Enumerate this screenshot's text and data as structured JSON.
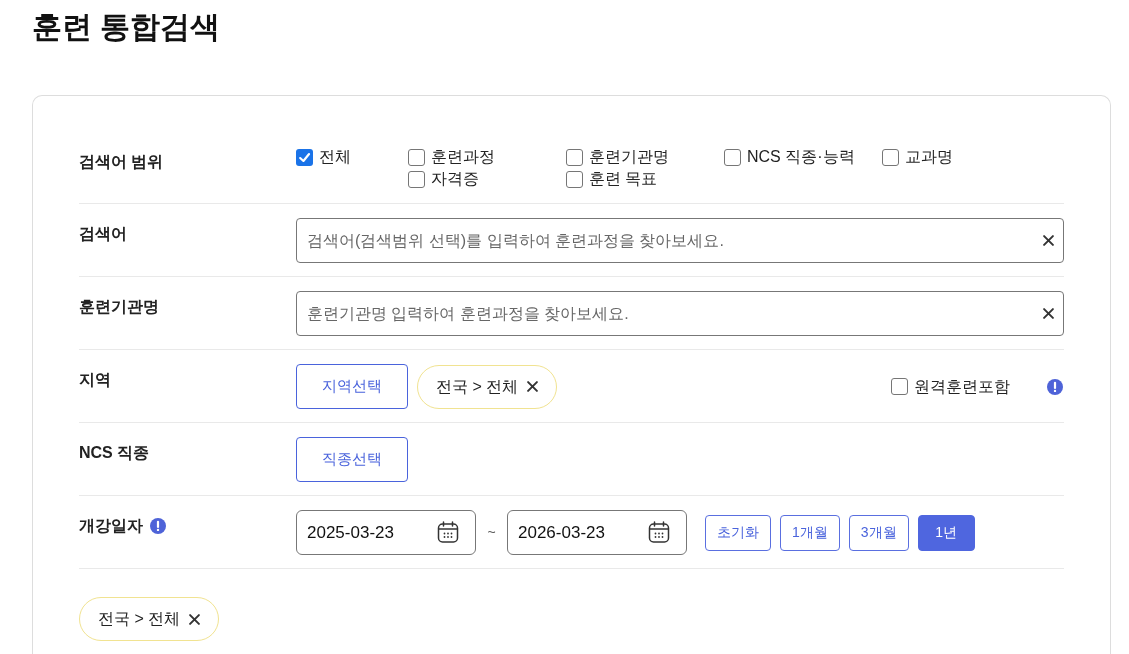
{
  "page": {
    "title": "훈련 통합검색"
  },
  "search_form": {
    "rows": [
      {
        "kind": "scope",
        "label": "검색어 범위",
        "options": [
          {
            "label": "전체",
            "checked": true
          },
          {
            "label": "훈련과정",
            "checked": false
          },
          {
            "label": "훈련기관명",
            "checked": false
          },
          {
            "label": "NCS 직종·능력",
            "checked": false
          },
          {
            "label": "교과명",
            "checked": false
          },
          {
            "label": "자격증",
            "checked": false
          },
          {
            "label": "훈련 목표",
            "checked": false
          }
        ]
      },
      {
        "kind": "text",
        "label": "검색어",
        "placeholder": "검색어(검색범위 선택)를 입력하여 훈련과정을 찾아보세요."
      },
      {
        "kind": "text",
        "label": "훈련기관명",
        "placeholder": "훈련기관명 입력하여 훈련과정을 찾아보세요."
      },
      {
        "kind": "region",
        "label": "지역",
        "button": "지역선택",
        "chips": [
          {
            "text": "전국 > 전체"
          }
        ],
        "remote": {
          "label": "원격훈련포함",
          "checked": false
        }
      },
      {
        "kind": "picker",
        "label": "NCS 직종",
        "button": "직종선택"
      },
      {
        "kind": "dates",
        "label": "개강일자",
        "start": "2025-03-23",
        "separator": "~",
        "end": "2026-03-23",
        "presets": [
          {
            "label": "초기화",
            "selected": false
          },
          {
            "label": "1개월",
            "selected": false
          },
          {
            "label": "3개월",
            "selected": false
          },
          {
            "label": "1년",
            "selected": true
          }
        ]
      }
    ]
  },
  "selected_chips": [
    {
      "text": "전국 > 전체"
    }
  ]
}
